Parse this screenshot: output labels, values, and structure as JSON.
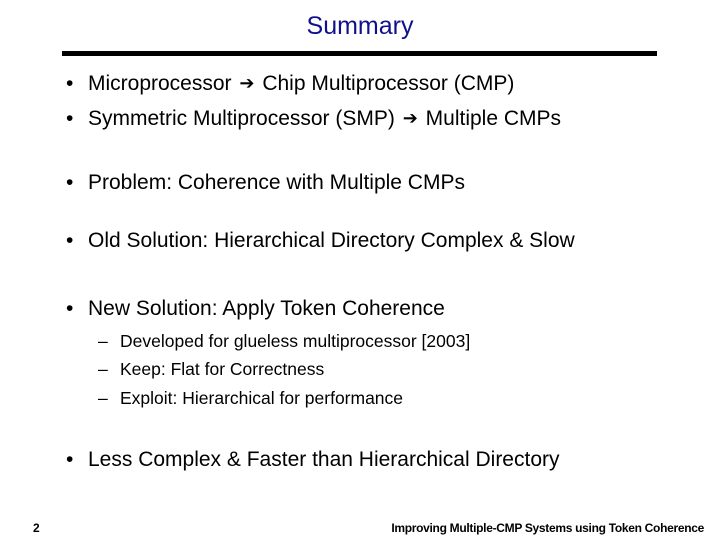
{
  "slide": {
    "title": "Summary",
    "bullets": [
      {
        "pre": "Microprocessor",
        "arrow": "➔",
        "post": "Chip Multiprocessor (CMP)"
      },
      {
        "pre": "Symmetric Multiprocessor (SMP)",
        "arrow": "➔",
        "post": "Multiple CMPs"
      },
      {
        "text": "Problem: Coherence with Multiple CMPs"
      },
      {
        "text": "Old Solution: Hierarchical Directory Complex & Slow"
      },
      {
        "text": "New Solution:  Apply Token Coherence"
      },
      {
        "text": "Less Complex & Faster than Hierarchical Directory"
      }
    ],
    "sub_bullets": [
      "Developed for glueless multiprocessor [2003]",
      "Keep: Flat for Correctness",
      "Exploit: Hierarchical for performance"
    ],
    "bullet_glyph": "•",
    "sub_glyph": "–",
    "page_number": "2",
    "footer": "Improving Multiple-CMP Systems using Token Coherence",
    "colors": {
      "title": "#10108c",
      "text": "#000000"
    }
  }
}
